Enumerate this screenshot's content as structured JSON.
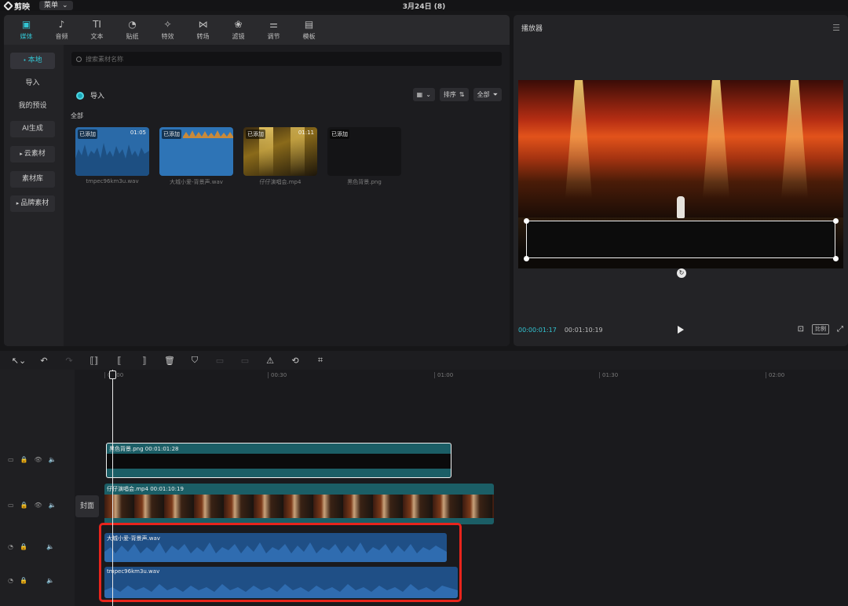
{
  "topbar": {
    "app_name": "剪映",
    "menu_label": "菜单",
    "menu_caret": "⌄",
    "project_title": "3月24日 (8)"
  },
  "tabs": [
    {
      "label": "媒体",
      "icon": "media-icon",
      "glyph": "▣"
    },
    {
      "label": "音频",
      "icon": "audio-icon",
      "glyph": "♪"
    },
    {
      "label": "文本",
      "icon": "text-icon",
      "glyph": "TI"
    },
    {
      "label": "贴纸",
      "icon": "sticker-icon",
      "glyph": "◔"
    },
    {
      "label": "特效",
      "icon": "effect-icon",
      "glyph": "✧"
    },
    {
      "label": "转场",
      "icon": "transition-icon",
      "glyph": "⋈"
    },
    {
      "label": "滤镜",
      "icon": "filter-icon",
      "glyph": "❀"
    },
    {
      "label": "调节",
      "icon": "adjust-icon",
      "glyph": "⚌"
    },
    {
      "label": "模板",
      "icon": "template-icon",
      "glyph": "▤"
    }
  ],
  "sidebar": [
    {
      "label": "本地",
      "caret": "•"
    },
    {
      "label": "导入",
      "caret": ""
    },
    {
      "label": "我的预设",
      "caret": ""
    },
    {
      "label": "AI生成",
      "caret": ""
    },
    {
      "label": "云素材",
      "caret": "▸"
    },
    {
      "label": "素材库",
      "caret": ""
    },
    {
      "label": "品牌素材",
      "caret": "▸"
    }
  ],
  "media": {
    "search_placeholder": "搜索素材名称",
    "import_label": "导入",
    "sort_label": "排序",
    "filter_label": "全部",
    "section_label": "全部",
    "items": [
      {
        "badge": "已添加",
        "duration": "01:05",
        "name": "tmpec96km3u.wav"
      },
      {
        "badge": "已添加",
        "duration": "",
        "name": "大城小爱-背景声.wav"
      },
      {
        "badge": "已添加",
        "duration": "01:11",
        "name": "仔仔演唱会.mp4"
      },
      {
        "badge": "已添加",
        "duration": "",
        "name": "黑色背景.png"
      }
    ]
  },
  "player": {
    "title": "播放器",
    "current_time": "00:00:01:17",
    "total_time": "00:01:10:19",
    "ratio_label": "比例"
  },
  "timeline": {
    "ruler_labels": [
      "00:00",
      "00:30",
      "01:00",
      "01:30",
      "02:00"
    ],
    "cover_label": "封面",
    "tracks": [
      {
        "name": "黑色背景.png",
        "duration": "00:01:01:28"
      },
      {
        "name": "仔仔演唱会.mp4",
        "duration": "00:01:10:19"
      },
      {
        "name": "大城小爱-背景声.wav",
        "duration": ""
      },
      {
        "name": "tmpec96km3u.wav",
        "duration": ""
      }
    ]
  },
  "colors": {
    "accent": "#33c4d2",
    "highlight": "#e8241c",
    "audio_clip": "#1f4f86",
    "video_clip": "#1b5e66"
  }
}
